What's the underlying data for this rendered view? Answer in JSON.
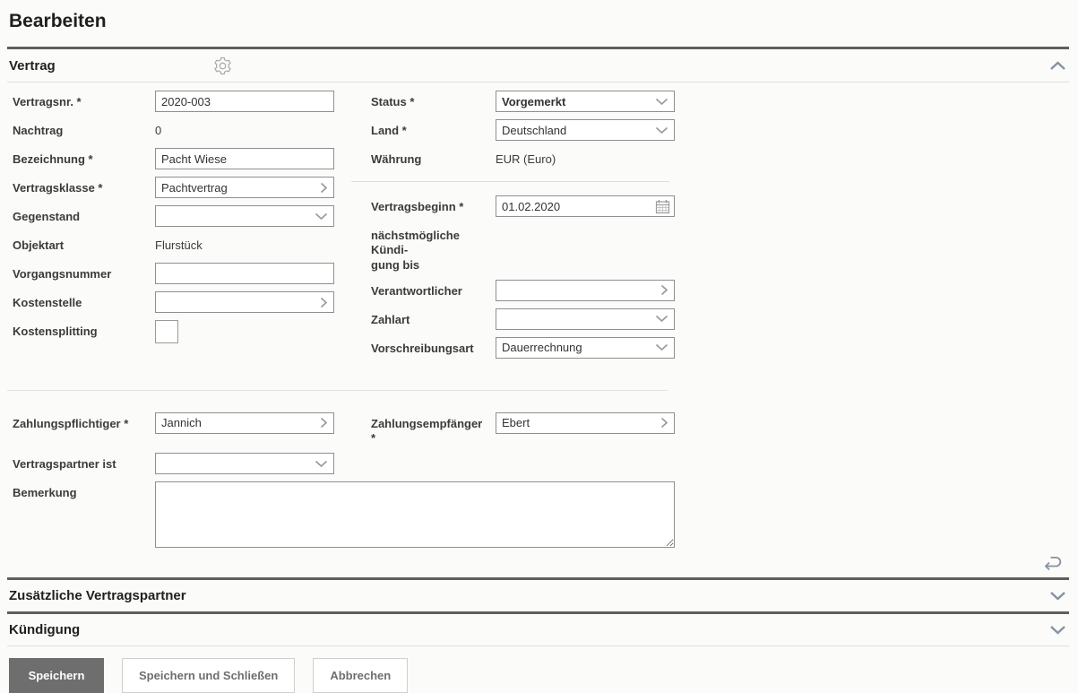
{
  "page": {
    "title": "Bearbeiten"
  },
  "colors": {
    "status_value_blue": "#2424dd",
    "primary_button_bg": "#6e6e6e",
    "section_rule_dark": "#5e5f60"
  },
  "icons": [
    "gear-icon",
    "chevron-up-icon",
    "chevron-down-icon",
    "chevron-right-icon",
    "calendar-icon",
    "undo-icon",
    "textarea-resize-handle"
  ],
  "vertrag": {
    "title": "Vertrag",
    "left": {
      "vertragsnr": {
        "label": "Vertragsnr. *",
        "value": "2020-003"
      },
      "nachtrag": {
        "label": "Nachtrag",
        "value": "0"
      },
      "bezeichnung": {
        "label": "Bezeichnung *",
        "value": "Pacht Wiese"
      },
      "vertragsklasse": {
        "label": "Vertragsklasse *",
        "value": "Pachtvertrag"
      },
      "gegenstand": {
        "label": "Gegenstand",
        "value": ""
      },
      "objektart": {
        "label": "Objektart",
        "value": "Flurstück"
      },
      "vorgangsnummer": {
        "label": "Vorgangsnummer",
        "value": ""
      },
      "kostenstelle": {
        "label": "Kostenstelle",
        "value": ""
      },
      "kostensplitting": {
        "label": "Kostensplitting",
        "checked": false
      }
    },
    "right": {
      "status": {
        "label": "Status *",
        "value": "Vorgemerkt"
      },
      "land": {
        "label": "Land *",
        "value": "Deutschland"
      },
      "waehrung": {
        "label": "Währung",
        "value": "EUR (Euro)"
      },
      "vertragsbeginn": {
        "label": "Vertragsbeginn *",
        "value": "01.02.2020"
      },
      "kuendigung_bis": {
        "label": "nächstmögliche Kündi-\ngung bis",
        "value": ""
      },
      "verantwortlicher": {
        "label": "Verantwortlicher",
        "value": ""
      },
      "zahlart": {
        "label": "Zahlart",
        "value": ""
      },
      "vorschreibungsart": {
        "label": "Vorschreibungsart",
        "value": "Dauerrechnung"
      }
    },
    "partners": {
      "zahlungspflichtiger": {
        "label": "Zahlungspflichtiger *",
        "value": "Jannich"
      },
      "zahlungsempfaenger": {
        "label": "Zahlungsempfänger *",
        "value": "Ebert"
      },
      "vertragspartner_ist": {
        "label": "Vertragspartner ist",
        "value": ""
      },
      "bemerkung": {
        "label": "Bemerkung",
        "value": ""
      }
    }
  },
  "collapsed_sections": {
    "zusaetzliche": {
      "title": "Zusätzliche Vertragspartner"
    },
    "kuendigung": {
      "title": "Kündigung"
    }
  },
  "buttons": {
    "save": "Speichern",
    "save_close": "Speichern und Schließen",
    "cancel": "Abbrechen"
  }
}
